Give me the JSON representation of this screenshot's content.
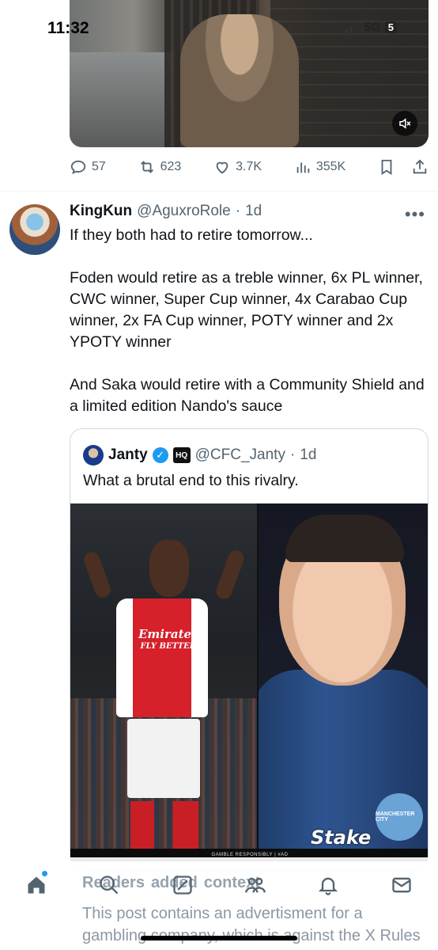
{
  "status_bar": {
    "time": "11:32",
    "network": "5G",
    "battery": "5"
  },
  "video": {
    "mute_icon": "speaker-muted-icon"
  },
  "prev_post_actions": {
    "replies": "57",
    "reposts": "623",
    "likes": "3.7K",
    "views": "355K"
  },
  "post": {
    "display_name": "KingKun",
    "handle": "@AguxroRole",
    "dot": "·",
    "time": "1d",
    "more": "•••",
    "paragraphs": [
      "If they both had to retire tomorrow...",
      "Foden would retire as a treble winner, 6x PL winner, CWC winner, Super Cup winner, 4x Carabao Cup winner, 2x FA Cup winner, POTY winner and 2x YPOTY winner",
      "And Saka would retire with a Community Shield and a limited edition Nando's sauce"
    ]
  },
  "quote": {
    "display_name": "Janty",
    "verified_mark": "✓",
    "affiliate_badge": "HQ",
    "handle": "@CFC_Janty",
    "dot": "·",
    "time": "1d",
    "text": "What a brutal end to this rivalry.",
    "media": {
      "left_shirt_line1": "Emirates",
      "left_shirt_line2": "FLY BETTER",
      "sponsor_logo": "Stake",
      "gamble_notice": "GAMBLE RESPONSIBLY | #AD",
      "club_badge": "MANCHESTER CITY"
    }
  },
  "context_note": {
    "title_parts": [
      "Readers",
      "added",
      "context"
    ],
    "body": "This post contains an advertisment for a gambling company, which is against the X Rules \"X prohibits the promotion of"
  },
  "tabbar": {
    "items": [
      "home-icon",
      "search-icon",
      "grok-icon",
      "communities-icon",
      "notifications-icon",
      "messages-icon"
    ]
  }
}
